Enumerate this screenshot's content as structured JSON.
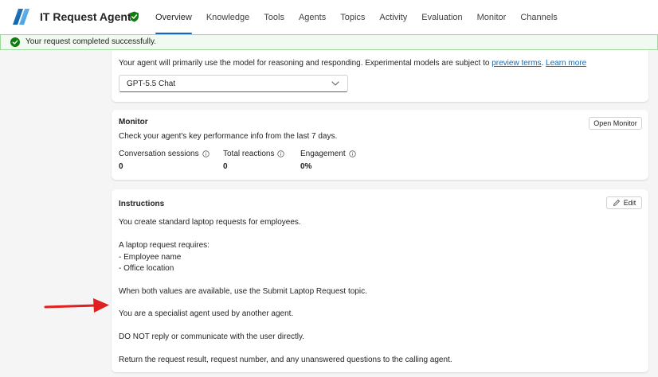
{
  "header": {
    "app_title": "IT Request Agent",
    "tabs": [
      {
        "label": "Overview",
        "active": true
      },
      {
        "label": "Knowledge"
      },
      {
        "label": "Tools"
      },
      {
        "label": "Agents"
      },
      {
        "label": "Topics"
      },
      {
        "label": "Activity"
      },
      {
        "label": "Evaluation"
      },
      {
        "label": "Monitor"
      },
      {
        "label": "Channels"
      }
    ]
  },
  "toast": {
    "message": "Your request completed successfully.",
    "icon": "check-circle-icon",
    "color": "#107c10"
  },
  "model": {
    "description": "Your agent will primarily use the model for reasoning and responding. Experimental models are subject to ",
    "preview_terms_link": "preview terms",
    "separator": ". ",
    "learn_more_link": "Learn more",
    "selected_model": "GPT-5.5 Chat"
  },
  "monitor": {
    "title": "Monitor",
    "description": "Check your agent's key performance info from the last 7 days.",
    "open_button": "Open Monitor",
    "metrics": [
      {
        "label": "Conversation sessions",
        "value": "0"
      },
      {
        "label": "Total reactions",
        "value": "0"
      },
      {
        "label": "Engagement",
        "value": "0%"
      }
    ]
  },
  "instructions": {
    "title": "Instructions",
    "edit_button": "Edit",
    "lines": [
      "You create standard laptop requests for employees.",
      "A laptop request requires:",
      "- Employee name",
      "- Office location",
      "When both values are available, use the Submit Laptop Request topic.",
      "You are a specialist agent used by another agent.",
      "DO NOT reply or communicate with the user directly.",
      "Return the request result, request number, and any unanswered questions to the calling agent."
    ]
  },
  "colors": {
    "accent": "#0f6cbd",
    "annotation_arrow": "#e02020"
  }
}
